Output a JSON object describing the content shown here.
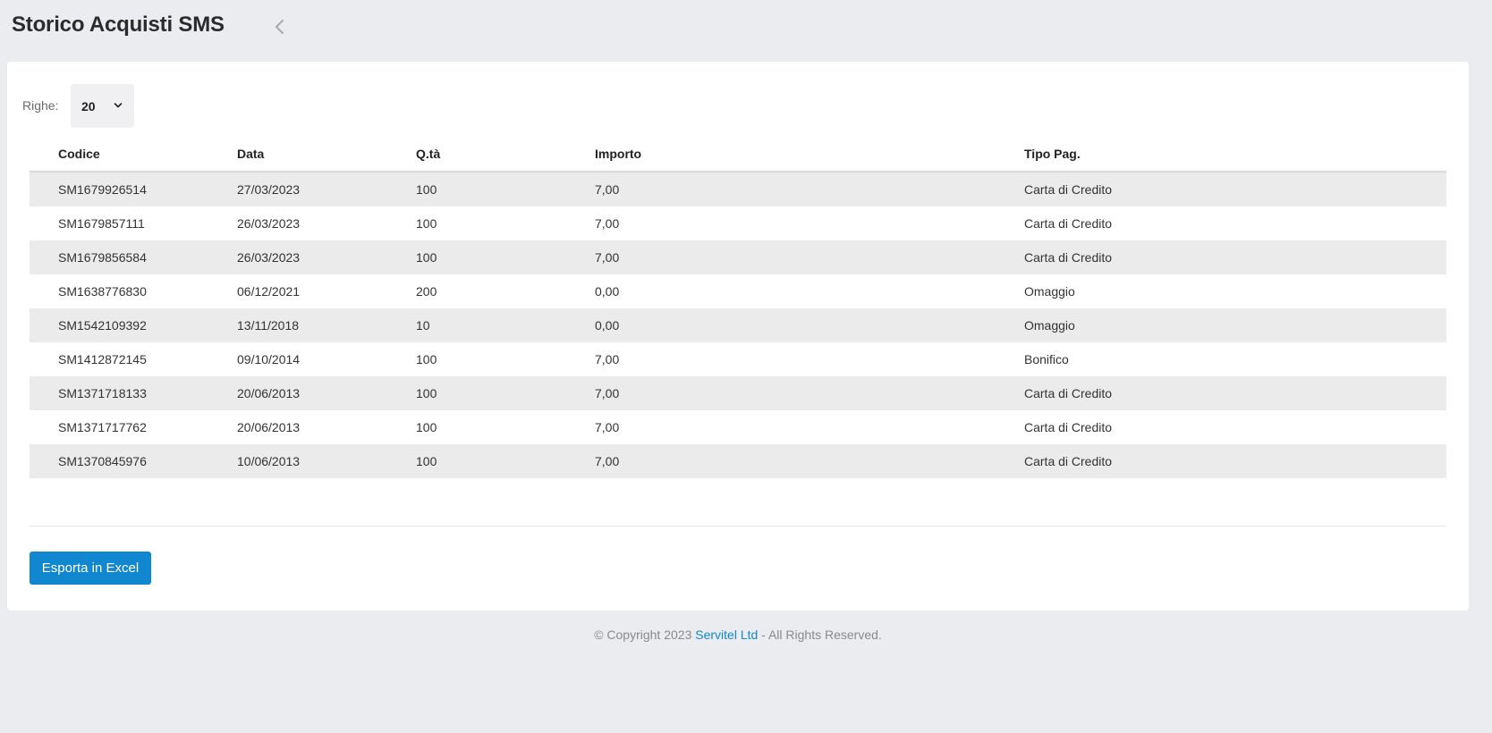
{
  "header": {
    "title": "Storico Acquisti SMS",
    "back_icon": "chevron-left-icon"
  },
  "controls": {
    "rows_label": "Righe:",
    "rows_value": "20",
    "rows_icon": "chevron-down-icon"
  },
  "table": {
    "columns": [
      "Codice",
      "Data",
      "Q.tà",
      "Importo",
      "Tipo Pag."
    ],
    "rows": [
      [
        "SM1679926514",
        "27/03/2023",
        "100",
        "7,00",
        "Carta di Credito"
      ],
      [
        "SM1679857111",
        "26/03/2023",
        "100",
        "7,00",
        "Carta di Credito"
      ],
      [
        "SM1679856584",
        "26/03/2023",
        "100",
        "7,00",
        "Carta di Credito"
      ],
      [
        "SM1638776830",
        "06/12/2021",
        "200",
        "0,00",
        "Omaggio"
      ],
      [
        "SM1542109392",
        "13/11/2018",
        "10",
        "0,00",
        "Omaggio"
      ],
      [
        "SM1412872145",
        "09/10/2014",
        "100",
        "7,00",
        "Bonifico"
      ],
      [
        "SM1371718133",
        "20/06/2013",
        "100",
        "7,00",
        "Carta di Credito"
      ],
      [
        "SM1371717762",
        "20/06/2013",
        "100",
        "7,00",
        "Carta di Credito"
      ],
      [
        "SM1370845976",
        "10/06/2013",
        "100",
        "7,00",
        "Carta di Credito"
      ]
    ]
  },
  "actions": {
    "export_label": "Esporta in Excel"
  },
  "footer": {
    "prefix": "© Copyright 2023 ",
    "brand": "Servitel Ltd",
    "suffix": " - All Rights Reserved."
  },
  "colors": {
    "background": "#ebecf0",
    "accent": "#1187d0",
    "row_stripe": "#ebebeb"
  }
}
